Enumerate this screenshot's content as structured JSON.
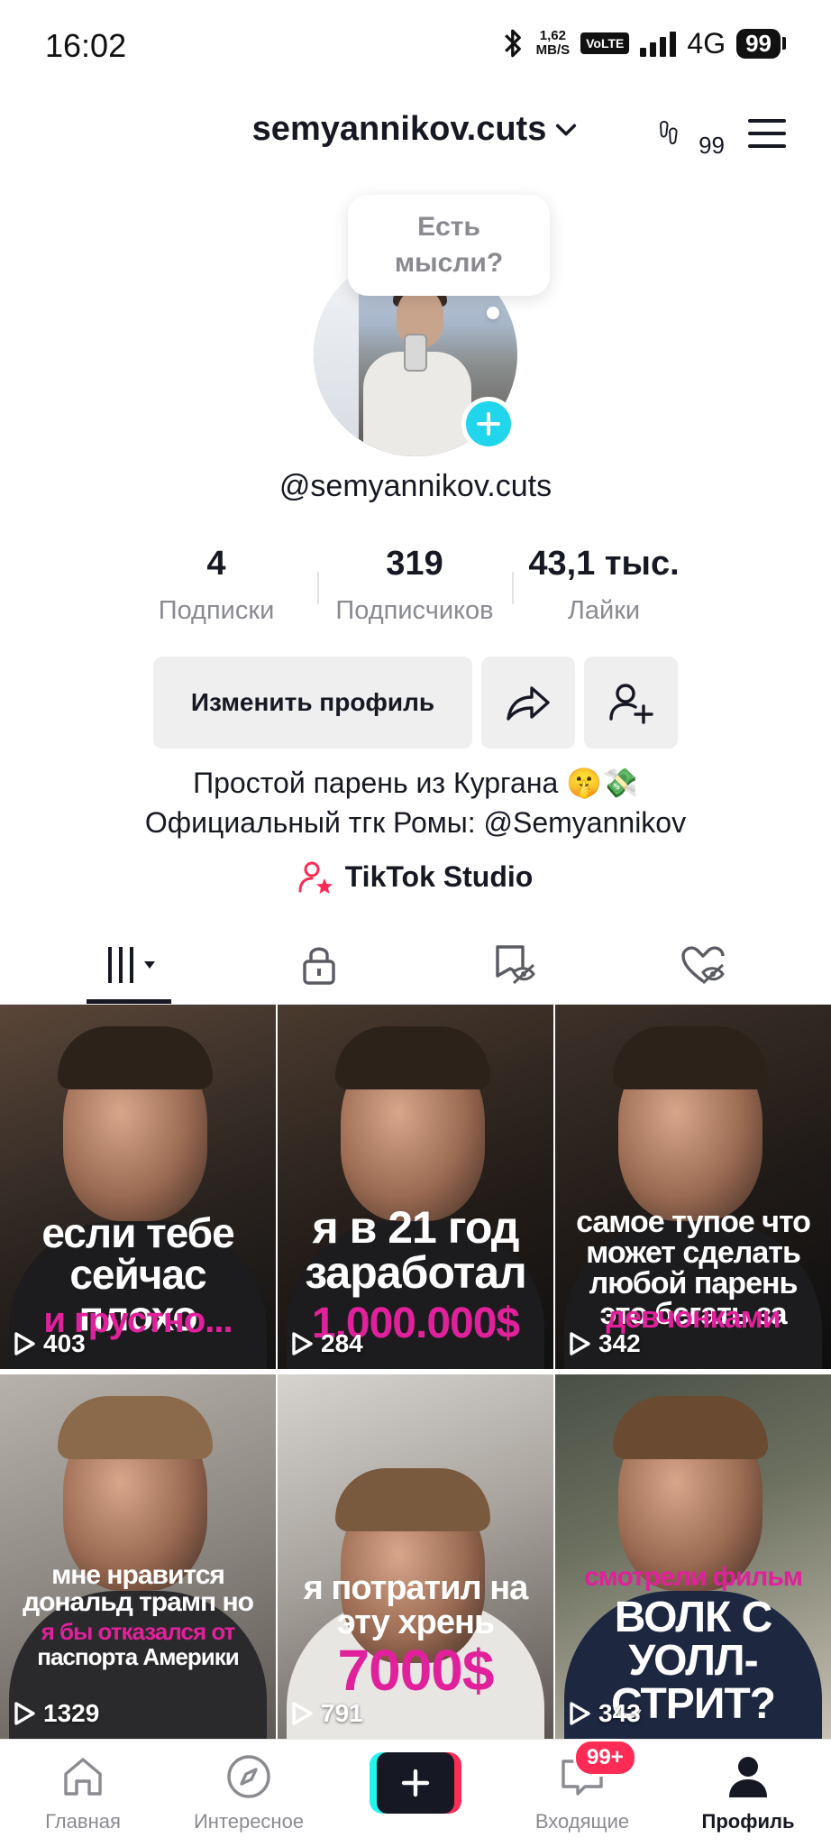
{
  "status_bar": {
    "time": "16:02",
    "net_speed_value": "1,62",
    "net_speed_unit": "MB/S",
    "volte": "VoLTE",
    "network": "4G",
    "battery": "99"
  },
  "header": {
    "username": "semyannikov.cuts",
    "footprints_count": "99"
  },
  "profile": {
    "thought_bubble": "Есть мысли?",
    "handle": "@semyannikov.cuts",
    "stats": [
      {
        "value": "4",
        "label": "Подписки"
      },
      {
        "value": "319",
        "label": "Подписчиков"
      },
      {
        "value": "43,1 тыс.",
        "label": "Лайки"
      }
    ],
    "edit_button": "Изменить профиль",
    "bio_line1": "Простой парень из Кургана 🤫💸",
    "bio_line2": "Официальный тгк Ромы: @Semyannikov",
    "studio_link": "TikTok Studio"
  },
  "videos": [
    {
      "views": "403",
      "caption_white": "если тебе сейчас плохо",
      "caption_pink": "и грустно..."
    },
    {
      "views": "284",
      "caption_white": "я в 21 год заработал",
      "caption_pink": "1.000.000$"
    },
    {
      "views": "342",
      "caption_white": "самое тупое что может сделать любой парень это бегать за",
      "caption_pink": "девчонками"
    },
    {
      "views": "1329",
      "caption_white": "мне нравится дональд трамп но",
      "caption_pink": "я бы отказался от",
      "caption_white2": "паспорта Америки"
    },
    {
      "views": "791",
      "caption_white": "я потратил на эту хрень",
      "caption_pink": "7000$"
    },
    {
      "views": "343",
      "caption_pink": "смотрели фильм",
      "caption_white": "ВОЛК С УОЛЛ-СТРИТ?"
    }
  ],
  "bottom_nav": {
    "home": "Главная",
    "explore": "Интересное",
    "inbox": "Входящие",
    "inbox_badge": "99+",
    "profile": "Профиль"
  },
  "colors": {
    "accent_cyan": "#20d5ec",
    "brand_pink": "#fe2c55",
    "caption_pink": "#e0219b",
    "text_primary": "#161823",
    "text_secondary": "#8a8b91"
  }
}
